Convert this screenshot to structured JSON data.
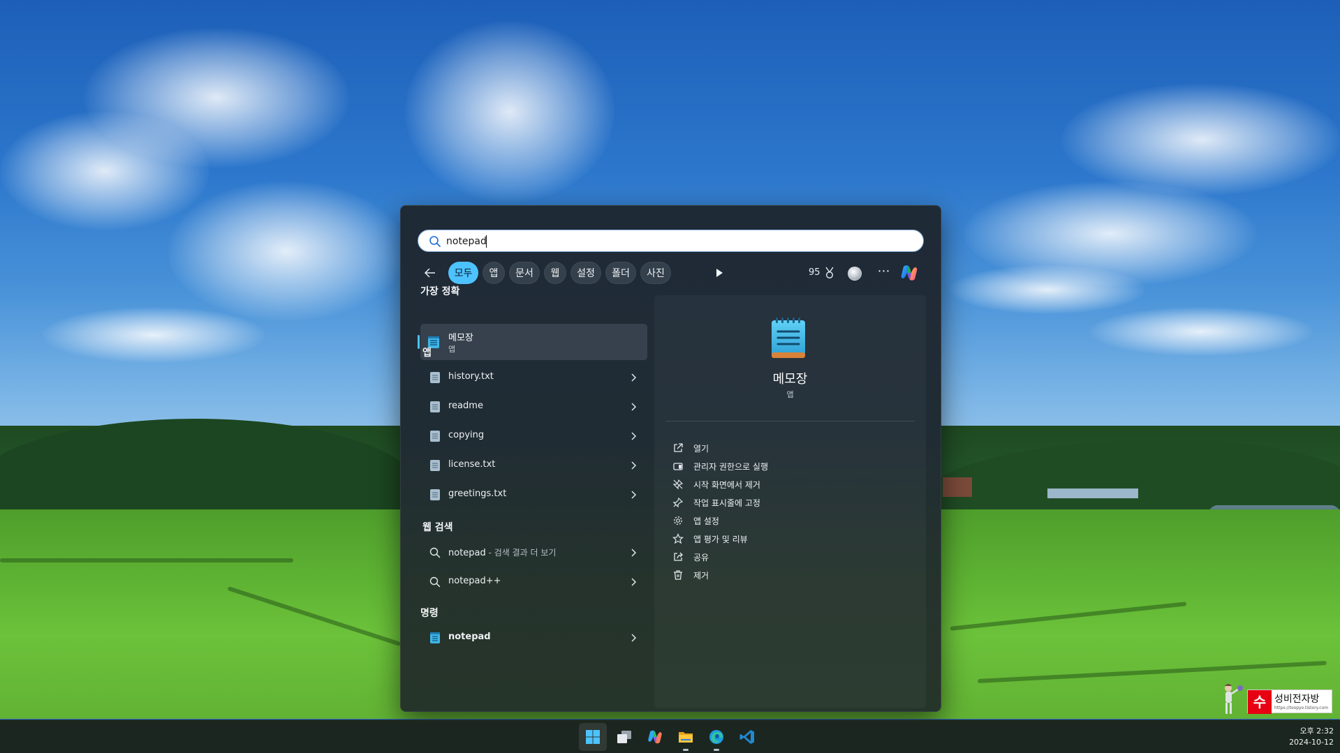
{
  "search": {
    "query": "notepad"
  },
  "filters": {
    "chips": [
      "모두",
      "앱",
      "문서",
      "웹",
      "설정",
      "폴더",
      "사진"
    ],
    "active": "모두",
    "points": "95"
  },
  "best_match": {
    "heading": "가장 정확",
    "name": "메모장",
    "type": "앱"
  },
  "apps": {
    "heading": "앱",
    "items": [
      "history.txt",
      "readme",
      "copying",
      "license.txt",
      "greetings.txt"
    ]
  },
  "web_search": {
    "heading": "웹 검색",
    "items": [
      {
        "label": "notepad",
        "suffix": " - 검색 결과 더 보기"
      },
      {
        "label": "notepad++",
        "suffix": ""
      }
    ]
  },
  "commands": {
    "heading": "명령",
    "items": [
      "notepad"
    ]
  },
  "detail": {
    "title": "메모장",
    "type": "앱",
    "actions": [
      {
        "label": "열기",
        "icon": "open-icon"
      },
      {
        "label": "관리자 권한으로 실행",
        "icon": "run-as-admin-icon"
      },
      {
        "label": "시작 화면에서 제거",
        "icon": "unpin-icon"
      },
      {
        "label": "작업 표시줄에 고정",
        "icon": "pin-icon"
      },
      {
        "label": "앱 설정",
        "icon": "gear-icon"
      },
      {
        "label": "앱 평가 및 리뷰",
        "icon": "star-icon"
      },
      {
        "label": "공유",
        "icon": "share-icon"
      },
      {
        "label": "제거",
        "icon": "trash-icon"
      }
    ]
  },
  "taskbar": {
    "apps": [
      "start-icon",
      "task-view-icon",
      "copilot-icon",
      "file-explorer-icon",
      "edge-icon",
      "vscode-icon"
    ]
  },
  "clock": {
    "time": "오후 2:32",
    "date": "2024-10-12"
  },
  "watermark": {
    "badge_char": "수",
    "title": "성비전자방",
    "url": "https://toopyo.tistory.com"
  },
  "colors": {
    "accent": "#4cc2ff",
    "panel_bg": "#202c34",
    "chip_bg": "#34404c",
    "taskbar_bg": "#1c2620"
  }
}
